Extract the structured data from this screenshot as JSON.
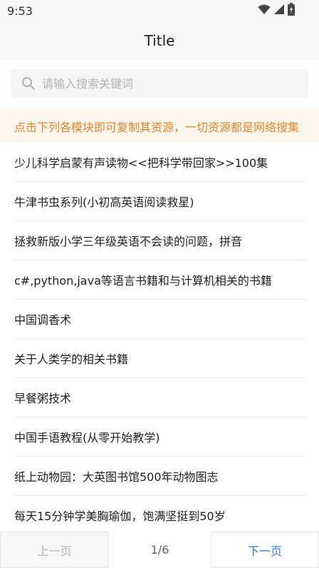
{
  "status_bar": {
    "time": "9:53",
    "icons": [
      "wifi-icon",
      "signal-icon",
      "battery-icon"
    ]
  },
  "nav": {
    "title": "Title"
  },
  "search": {
    "placeholder": "请输入搜索关键词",
    "value": ""
  },
  "notice": {
    "text": "点击下列各模块即可复制其资源，一切资源都是网络搜集",
    "color": "#e6862b",
    "background": "#fdf6ec"
  },
  "list": {
    "items": [
      "少儿科学启蒙有声读物<<把科学带回家>>100集",
      "牛津书虫系列(小初高英语阅读救星)",
      "拯救新版小学三年级英语不会读的问题，拼音",
      "c#,python,java等语言书籍和与计算机相关的书籍",
      "中国调香术",
      "关于人类学的相关书籍",
      "早餐粥技术",
      "中国手语教程(从零开始教学)",
      "纸上动物园：大英图书馆500年动物图志",
      "每天15分钟学美胸瑜伽，饱满坚挺到50岁"
    ]
  },
  "pager": {
    "prev_label": "上一页",
    "page_indicator": "1/6",
    "next_label": "下一页",
    "next_color": "#2f79e8"
  }
}
